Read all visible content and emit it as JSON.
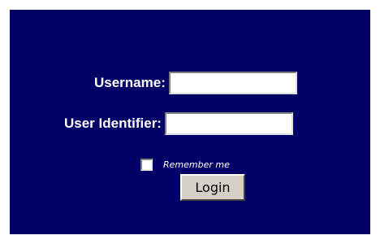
{
  "login_form": {
    "username_label": "Username:",
    "username_value": "",
    "identifier_label": "User Identifier:",
    "identifier_value": "",
    "remember_label": "Remember me",
    "remember_checked": false,
    "login_label": "Login"
  },
  "colors": {
    "panel_background": "#000066",
    "label_text": "#ffffff",
    "button_face": "#d4d0c8"
  }
}
